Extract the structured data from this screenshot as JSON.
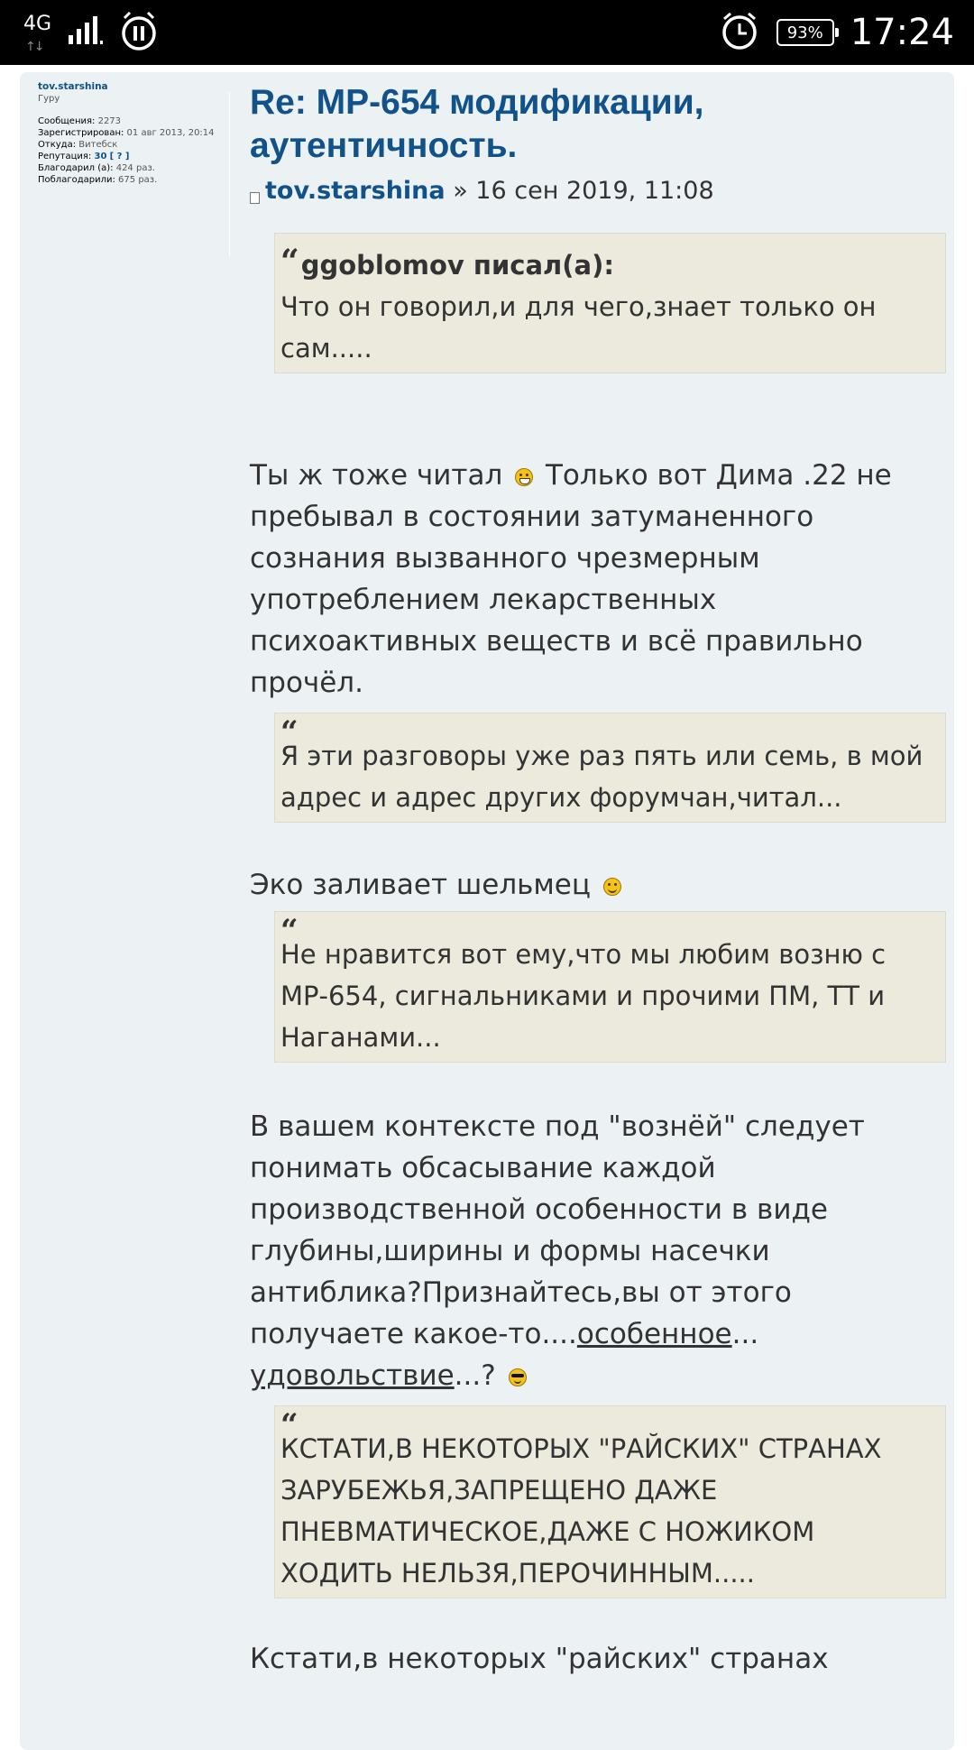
{
  "status_bar": {
    "network_type": "4G",
    "network_arrows": "↑↓",
    "battery": "93%",
    "time": "17:24",
    "icons": [
      "signal-icon",
      "pause-circle-icon",
      "alarm-icon",
      "battery-icon"
    ]
  },
  "profile": {
    "username": "tov.starshina",
    "rank": "Гуру",
    "posts_label": "Сообщения:",
    "posts_value": "2273",
    "registered_label": "Зарегистрирован:",
    "registered_value": "01 авг 2013, 20:14",
    "from_label": "Откуда:",
    "from_value": "Витебск",
    "reputation_label": "Репутация:",
    "reputation_value": "30",
    "reputation_help": "[ ? ]",
    "thanked_label": "Благодарил (а):",
    "thanked_value": "424 раз.",
    "was_thanked_label": "Поблагодарили:",
    "was_thanked_value": "675 раз."
  },
  "post": {
    "title": "Re: МР-654 модификации, аутентичность.",
    "author": "tov.starshina",
    "date_text": " » 16 сен 2019, 11:08",
    "quote1_author": "ggoblomov писал(а):",
    "quote1_text": "Что он говорил,и для чего,знает только он сам.....",
    "para1_a": "Ты ж тоже читал",
    "para1_b": " Только вот Дима .22 не пребывал в состоянии затуманенного сознания вызванного чрезмерным употреблением лекарственных психоактивных веществ и всё правильно прочёл.",
    "quote2_text": "Я эти разговоры уже раз пять или семь, в мой адрес и адрес других форумчан,читал...",
    "para2": "Эко заливает шельмец",
    "quote3_text": "Не нравится вот ему,что мы любим возню с МР-654, сигнальниками и прочими ПМ, ТТ и Наганами...",
    "para3_a": "В вашем контексте под \"вознёй\" следует понимать обсасывание каждой производственной особенности в виде глубины,ширины и формы насечки антиблика?Признайтесь,вы от этого получаете какое-то....",
    "para3_u1": "особенное",
    "para3_b": "...",
    "para3_u2": "удовольствие",
    "para3_c": "...?",
    "quote4_text": "КСТАТИ,В НЕКОТОРЫХ \"РАЙСКИХ\" СТРАНАХ ЗАРУБЕЖЬЯ,ЗАПРЕЩЕНО ДАЖЕ ПНЕВМАТИЧЕСКОЕ,ДАЖЕ С НОЖИКОМ ХОДИТЬ НЕЛЬЗЯ,ПЕРОЧИННЫМ.....",
    "para4": "Кстати,в некоторых \"райских\" странах",
    "quote_mark": "“"
  },
  "colors": {
    "link": "#105289",
    "quote_bg": "#ebeadd",
    "post_bg": "#ecf1f3"
  }
}
